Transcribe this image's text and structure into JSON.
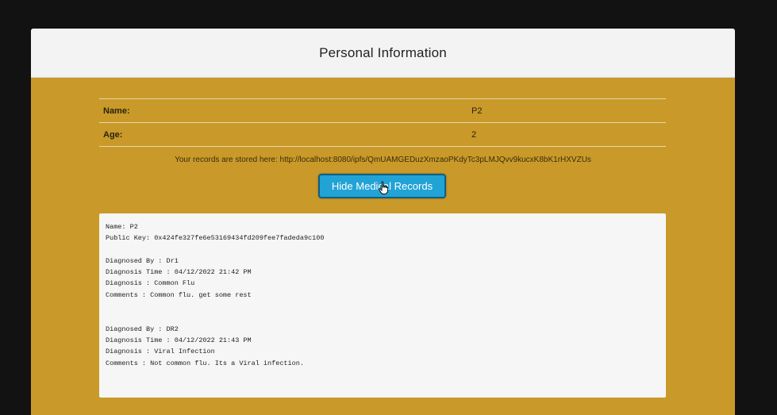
{
  "header": {
    "title": "Personal Information"
  },
  "info": [
    {
      "label": "Name:",
      "value": "P2"
    },
    {
      "label": "Age:",
      "value": "2"
    }
  ],
  "storage_text": "Your records are stored here: http://localhost:8080/ipfs/QmUAMGEDuzXmzaoPKdyTc3pLMJQvv9kucxK8bK1rHXVZUs",
  "toggle_button_label": "Hide Medical Records",
  "records": {
    "name_line": "Name: P2",
    "key_line": "Public Key: 0x424fe327fe6e53169434fd209fee7fadeda9c100",
    "entries": [
      {
        "diagnosed_by": "Diagnosed By : Dr1",
        "time": "Diagnosis Time : 04/12/2022 21:42 PM",
        "diagnosis": "Diagnosis : Common Flu",
        "comments": "Comments : Common flu. get some rest"
      },
      {
        "diagnosed_by": "Diagnosed By : DR2",
        "time": "Diagnosis Time : 04/12/2022 21:43 PM",
        "diagnosis": "Diagnosis : Viral Infection",
        "comments": "Comments : Not common flu. Its a Viral infection."
      }
    ]
  },
  "colors": {
    "page_bg": "#121212",
    "card_bg": "#c99a2a",
    "header_bg": "#f3f3f3",
    "button_bg": "#22a3d6",
    "records_bg": "#f6f6f6"
  }
}
